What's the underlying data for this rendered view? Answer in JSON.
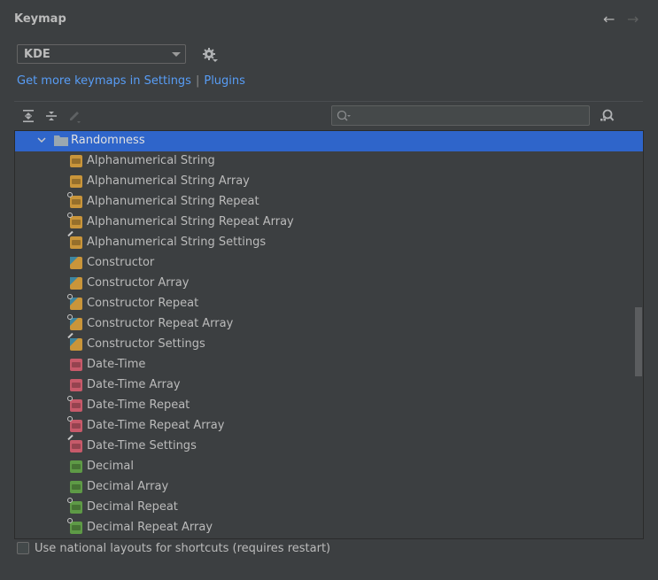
{
  "header": {
    "title": "Keymap",
    "back_icon": "arrow-left-icon",
    "forward_icon": "arrow-right-icon"
  },
  "keymap_select": {
    "selected": "KDE",
    "settings_icon": "gear-icon"
  },
  "links": {
    "settings": "Get more keymaps in Settings",
    "separator": "|",
    "plugins": "Plugins"
  },
  "toolbar": {
    "expand_all_icon": "expand-all-icon",
    "collapse_all_icon": "collapse-all-icon",
    "edit_icon": "edit-icon",
    "search_placeholder": "",
    "search_value": "",
    "find_shortcut_icon": "find-by-shortcut-icon"
  },
  "tree": {
    "group": {
      "label": "Randomness",
      "expanded": true,
      "selected": true
    },
    "items": [
      {
        "label": "Alphanumerical String",
        "kind": "string",
        "modifier": ""
      },
      {
        "label": "Alphanumerical String Array",
        "kind": "string",
        "modifier": ""
      },
      {
        "label": "Alphanumerical String Repeat",
        "kind": "string",
        "modifier": "repeat"
      },
      {
        "label": "Alphanumerical String Repeat Array",
        "kind": "string",
        "modifier": "repeat"
      },
      {
        "label": "Alphanumerical String Settings",
        "kind": "string",
        "modifier": "settings"
      },
      {
        "label": "Constructor",
        "kind": "constructor",
        "modifier": ""
      },
      {
        "label": "Constructor Array",
        "kind": "constructor",
        "modifier": ""
      },
      {
        "label": "Constructor Repeat",
        "kind": "constructor",
        "modifier": "repeat"
      },
      {
        "label": "Constructor Repeat Array",
        "kind": "constructor",
        "modifier": "repeat"
      },
      {
        "label": "Constructor Settings",
        "kind": "constructor",
        "modifier": "settings"
      },
      {
        "label": "Date-Time",
        "kind": "datetime",
        "modifier": ""
      },
      {
        "label": "Date-Time Array",
        "kind": "datetime",
        "modifier": ""
      },
      {
        "label": "Date-Time Repeat",
        "kind": "datetime",
        "modifier": "repeat"
      },
      {
        "label": "Date-Time Repeat Array",
        "kind": "datetime",
        "modifier": "repeat"
      },
      {
        "label": "Date-Time Settings",
        "kind": "datetime",
        "modifier": "settings"
      },
      {
        "label": "Decimal",
        "kind": "decimal",
        "modifier": ""
      },
      {
        "label": "Decimal Array",
        "kind": "decimal",
        "modifier": ""
      },
      {
        "label": "Decimal Repeat",
        "kind": "decimal",
        "modifier": "repeat"
      },
      {
        "label": "Decimal Repeat Array",
        "kind": "decimal",
        "modifier": "repeat"
      }
    ],
    "kind_colors": {
      "string": "#c9953a",
      "constructor": "#c9953a",
      "datetime": "#c75a6a",
      "decimal": "#5e9a46"
    }
  },
  "footer": {
    "checkbox_label": "Use national layouts for shortcuts (requires restart)",
    "checked": false
  }
}
